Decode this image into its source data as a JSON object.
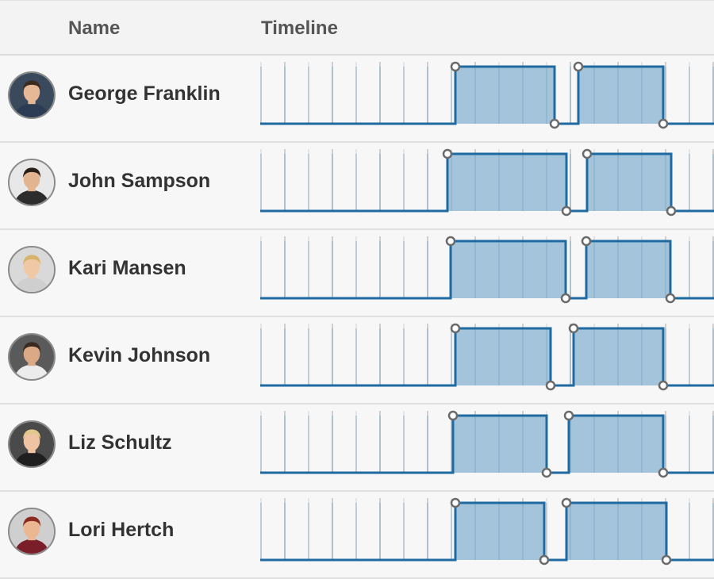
{
  "header": {
    "name_label": "Name",
    "timeline_label": "Timeline"
  },
  "people": [
    {
      "name": "George Franklin",
      "avatar": {
        "bg": "#3a4a5c",
        "skin": "#e6b896",
        "hair": "#3b2a20",
        "shirt": "#2d3c55"
      },
      "segments": [
        {
          "start": 246,
          "end": 371
        },
        {
          "start": 401,
          "end": 508
        }
      ]
    },
    {
      "name": "John Sampson",
      "avatar": {
        "bg": "#e8e8e8",
        "skin": "#e2b48f",
        "hair": "#2b2018",
        "shirt": "#2c2c2c"
      },
      "segments": [
        {
          "start": 236,
          "end": 386
        },
        {
          "start": 412,
          "end": 518
        }
      ]
    },
    {
      "name": "Kari Mansen",
      "avatar": {
        "bg": "#d9d9d9",
        "skin": "#f0c8a6",
        "hair": "#d8b46a",
        "shirt": "#cfcfcf"
      },
      "segments": [
        {
          "start": 240,
          "end": 385
        },
        {
          "start": 411,
          "end": 517
        }
      ]
    },
    {
      "name": "Kevin Johnson",
      "avatar": {
        "bg": "#5a5a5a",
        "skin": "#dca987",
        "hair": "#3a2a1e",
        "shirt": "#ececec"
      },
      "segments": [
        {
          "start": 246,
          "end": 366
        },
        {
          "start": 395,
          "end": 508
        }
      ]
    },
    {
      "name": "Liz Schultz",
      "avatar": {
        "bg": "#4a4a4a",
        "skin": "#f0c4a2",
        "hair": "#e2c98a",
        "shirt": "#1f1f1f"
      },
      "segments": [
        {
          "start": 243,
          "end": 361
        },
        {
          "start": 389,
          "end": 508
        }
      ]
    },
    {
      "name": "Lori Hertch",
      "avatar": {
        "bg": "#cfcfcf",
        "skin": "#eab792",
        "hair": "#8a2a20",
        "shirt": "#7a1f2a"
      },
      "segments": [
        {
          "start": 246,
          "end": 358
        },
        {
          "start": 386,
          "end": 512
        }
      ]
    }
  ],
  "timeline_colors": {
    "line": "#1f6aa0",
    "fill": "#9fc1d9",
    "grid": "#cfcfcf",
    "grid_light": "#e4e4e4",
    "marker_stroke": "#6a6a6a",
    "marker_fill": "#ffffff"
  }
}
